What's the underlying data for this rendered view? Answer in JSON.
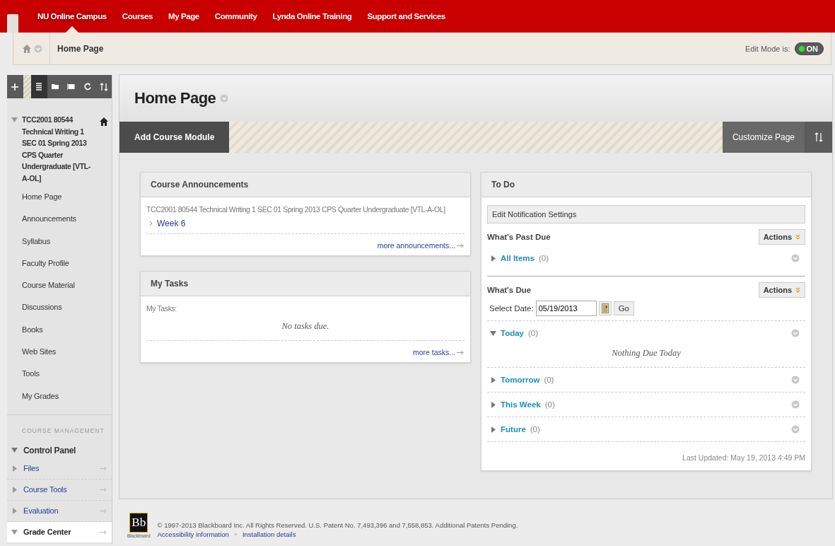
{
  "nav": {
    "tabs": [
      {
        "label": "NU Online Campus",
        "selected": true
      },
      {
        "label": "Courses",
        "selected": false
      },
      {
        "label": "My Page",
        "selected": false
      },
      {
        "label": "Community",
        "selected": false
      },
      {
        "label": "Lynda Online Training",
        "selected": false
      },
      {
        "label": "Support and Services",
        "selected": false
      }
    ]
  },
  "breadcrumb": {
    "label": "Home Page"
  },
  "edit_mode": {
    "label": "Edit Mode is:",
    "state": "ON",
    "on": true
  },
  "sidebar": {
    "tools": [
      {
        "kind": "add",
        "selected": false
      },
      {
        "kind": "list",
        "selected": true
      },
      {
        "kind": "folder",
        "selected": false
      },
      {
        "kind": "window",
        "selected": false
      },
      {
        "kind": "refresh",
        "selected": false
      },
      {
        "kind": "sort",
        "selected": false
      }
    ],
    "course_title": "TCC2001 80544 Technical Writing 1 SEC 01 Spring 2013 CPS Quarter Undergraduate [VTL-A-OL]",
    "expanded": true,
    "items": [
      {
        "label": "Home Page"
      },
      {
        "label": "Announcements"
      },
      {
        "label": "Syllabus"
      },
      {
        "label": "Faculty Profile"
      },
      {
        "label": "Course Material"
      },
      {
        "label": "Discussions"
      },
      {
        "label": "Books"
      },
      {
        "label": "Web Sites"
      },
      {
        "label": "Tools"
      },
      {
        "label": "My Grades"
      }
    ],
    "management": {
      "heading": "COURSE MANAGEMENT",
      "panel": {
        "label": "Control Panel",
        "expanded": true
      },
      "items": [
        {
          "label": "Files",
          "expanded": false
        },
        {
          "label": "Course Tools",
          "expanded": false
        },
        {
          "label": "Evaluation",
          "expanded": false
        },
        {
          "label": "Grade Center",
          "expanded": true
        }
      ]
    }
  },
  "content": {
    "title": "Home Page",
    "add_button": "Add Course Module",
    "customize_button": "Customize Page",
    "announcements": {
      "title": "Course Announcements",
      "course": "TCC2001 80544 Technical Writing 1 SEC 01 Spring 2013 CPS Quarter Undergraduate [VTL-A-OL]",
      "link": "Week 6",
      "more": "more announcements..."
    },
    "tasks": {
      "title": "My Tasks",
      "label": "My Tasks:",
      "empty": "No tasks due.",
      "more": "more tasks..."
    },
    "todo": {
      "title": "To Do",
      "settings_button": "Edit Notification Settings",
      "past_due": {
        "heading": "What's Past Due",
        "actions": "Actions",
        "groups": [
          {
            "label": "All Items",
            "count": "(0)",
            "expanded": false
          }
        ]
      },
      "due": {
        "heading": "What's Due",
        "actions": "Actions",
        "date_label": "Select Date:",
        "date": "05/19/2013",
        "go": "Go",
        "groups": [
          {
            "label": "Today",
            "count": "(0)",
            "expanded": true,
            "empty": "Nothing Due Today"
          },
          {
            "label": "Tomorrow",
            "count": "(0)",
            "expanded": false
          },
          {
            "label": "This Week",
            "count": "(0)",
            "expanded": false
          },
          {
            "label": "Future",
            "count": "(0)",
            "expanded": false
          }
        ]
      },
      "updated": "Last Updated: May 19, 2013 4:49 PM"
    }
  },
  "footer": {
    "logo": "Bb",
    "logo_caption": "Blackboard",
    "copyright": "© 1997-2013 Blackboard Inc. All Rights Reserved. U.S. Patent No. 7,493,396 and 7,558,853. Additional Patents Pending.",
    "links": [
      "Accessibility information",
      "Installation details"
    ]
  }
}
